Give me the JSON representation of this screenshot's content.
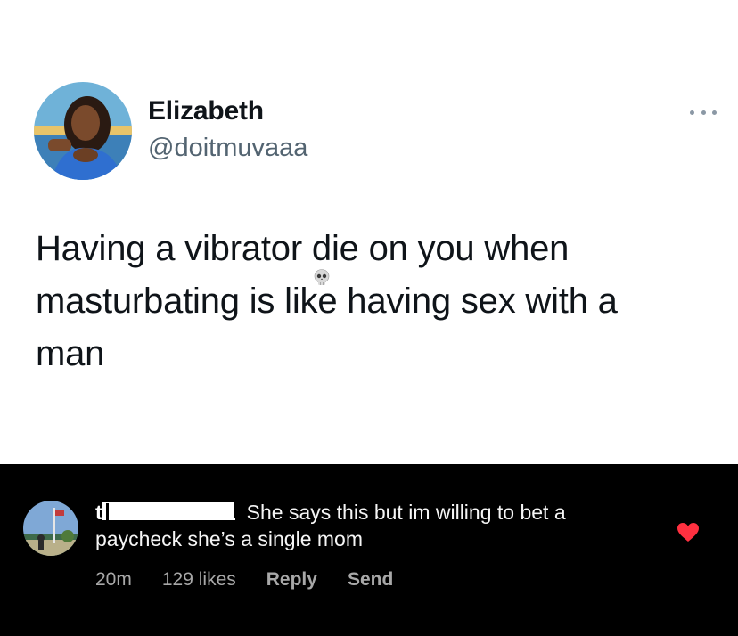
{
  "tweet": {
    "author_name": "Elizabeth",
    "author_handle": "@doitmuvaaa",
    "text_line1": "Having a vibrator d",
    "text_line1b": "ie on you when",
    "text_line2": "masturbating is like having sex with a",
    "text_line3": "man",
    "more_icon": "ellipsis-icon",
    "emoji_icon": "skull-icon"
  },
  "comment": {
    "username_visible": "t",
    "text": "She says this but im willing to bet a paycheck she’s a single mom",
    "text_line1": "She says this but im willing to bet a",
    "text_line2": "paycheck she’s a single mom",
    "time": "20m",
    "likes": "129 likes",
    "reply_label": "Reply",
    "send_label": "Send",
    "liked": true,
    "heart_color": "#ff3040"
  },
  "colors": {
    "tweet_bg": "#ffffff",
    "comment_bg": "#000000",
    "handle": "#536471"
  }
}
